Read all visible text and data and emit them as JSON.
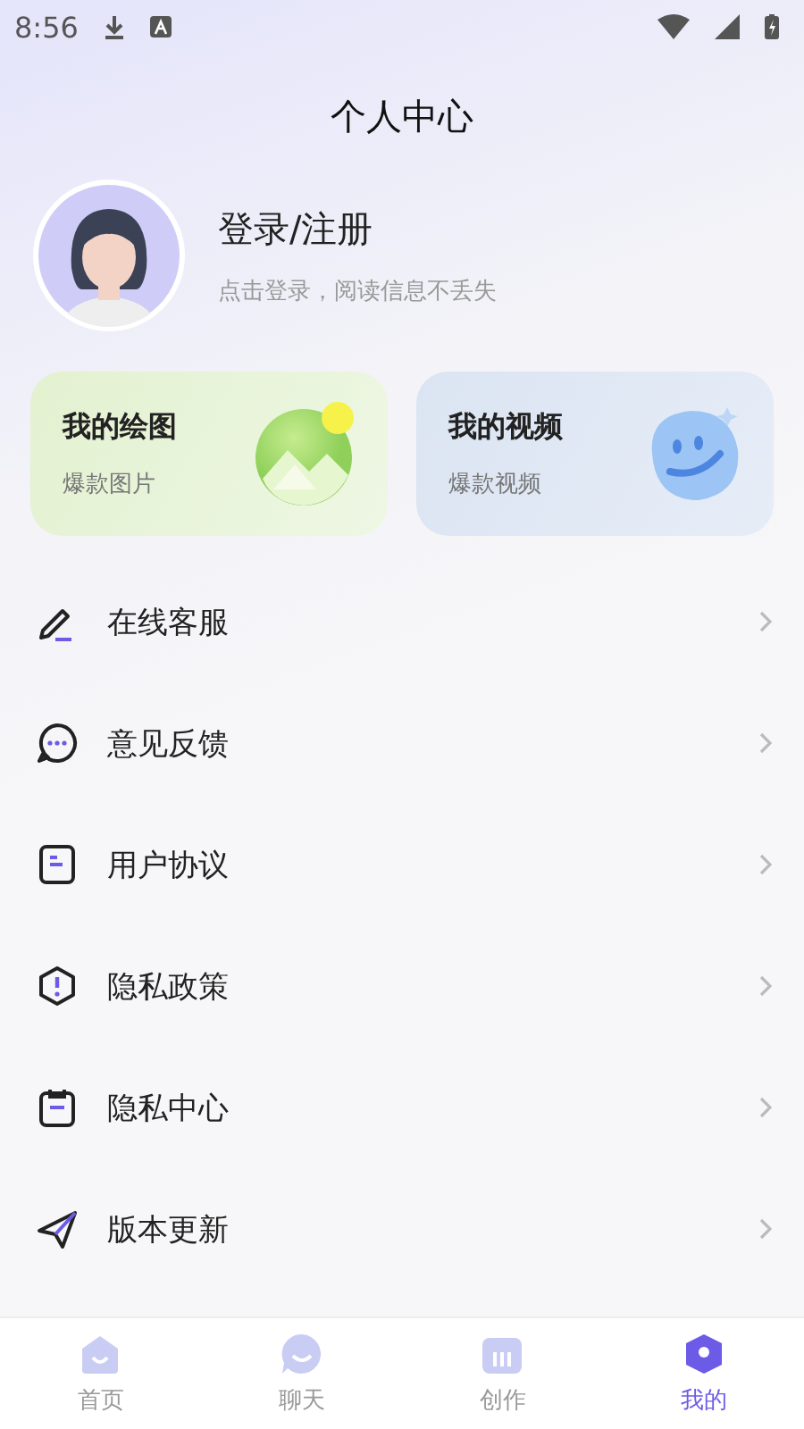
{
  "status_bar": {
    "time": "8:56"
  },
  "header": {
    "title": "个人中心"
  },
  "profile": {
    "name": "登录/注册",
    "hint": "点击登录，阅读信息不丢失"
  },
  "cards": [
    {
      "kind": "drawing",
      "title": "我的绘图",
      "subtitle": "爆款图片"
    },
    {
      "kind": "video",
      "title": "我的视频",
      "subtitle": "爆款视频"
    }
  ],
  "menu": [
    {
      "kind": "service",
      "label": "在线客服"
    },
    {
      "kind": "feedback",
      "label": "意见反馈"
    },
    {
      "kind": "agreement",
      "label": "用户协议"
    },
    {
      "kind": "privacy",
      "label": "隐私政策"
    },
    {
      "kind": "privacy-center",
      "label": "隐私中心"
    },
    {
      "kind": "update",
      "label": "版本更新"
    }
  ],
  "tabs": [
    {
      "kind": "home",
      "label": "首页",
      "selected": false
    },
    {
      "kind": "chat",
      "label": "聊天",
      "selected": false
    },
    {
      "kind": "create",
      "label": "创作",
      "selected": false
    },
    {
      "kind": "mine",
      "label": "我的",
      "selected": true
    }
  ]
}
